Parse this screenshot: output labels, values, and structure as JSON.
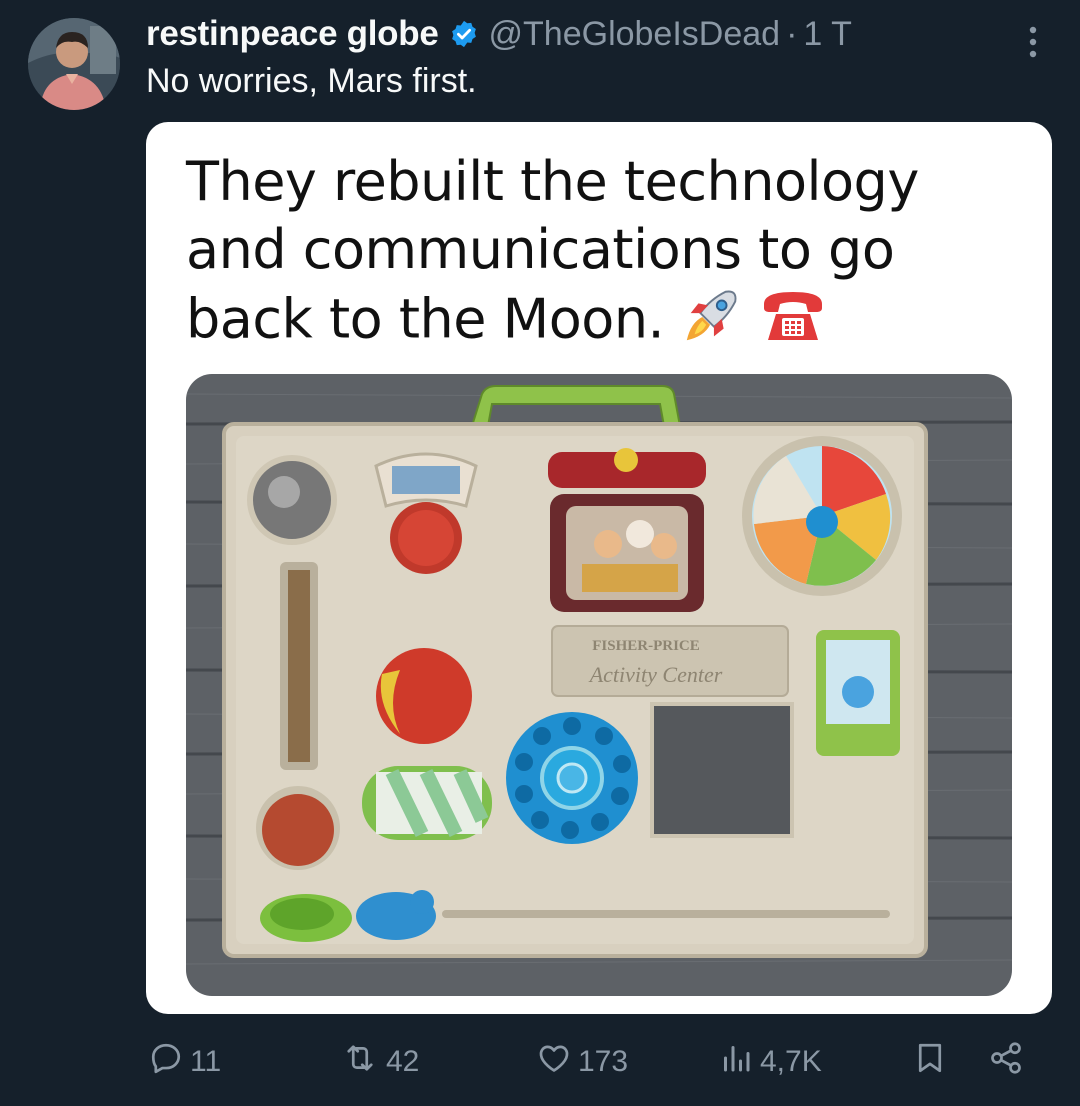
{
  "tweet": {
    "display_name": "restinpeace globe",
    "handle": "@TheGlobeIsDead",
    "separator": "·",
    "time": "1 T",
    "text": "No worries, Mars first.",
    "verified": true,
    "more_icon": "more-vertical-icon"
  },
  "media": {
    "caption": "They rebuilt the technology and communications to go back to the Moon.",
    "caption_emojis": [
      "rocket",
      "telephone"
    ],
    "photo_brand_line1": "FISHER-PRICE",
    "photo_brand_line2": "Activity Center"
  },
  "actions": {
    "replies": "11",
    "reposts": "42",
    "likes": "173",
    "views": "4,7K"
  },
  "colors": {
    "background": "#15202b",
    "verified": "#1d9bf0",
    "muted": "#8b98a5",
    "text": "#f7f9f9"
  }
}
